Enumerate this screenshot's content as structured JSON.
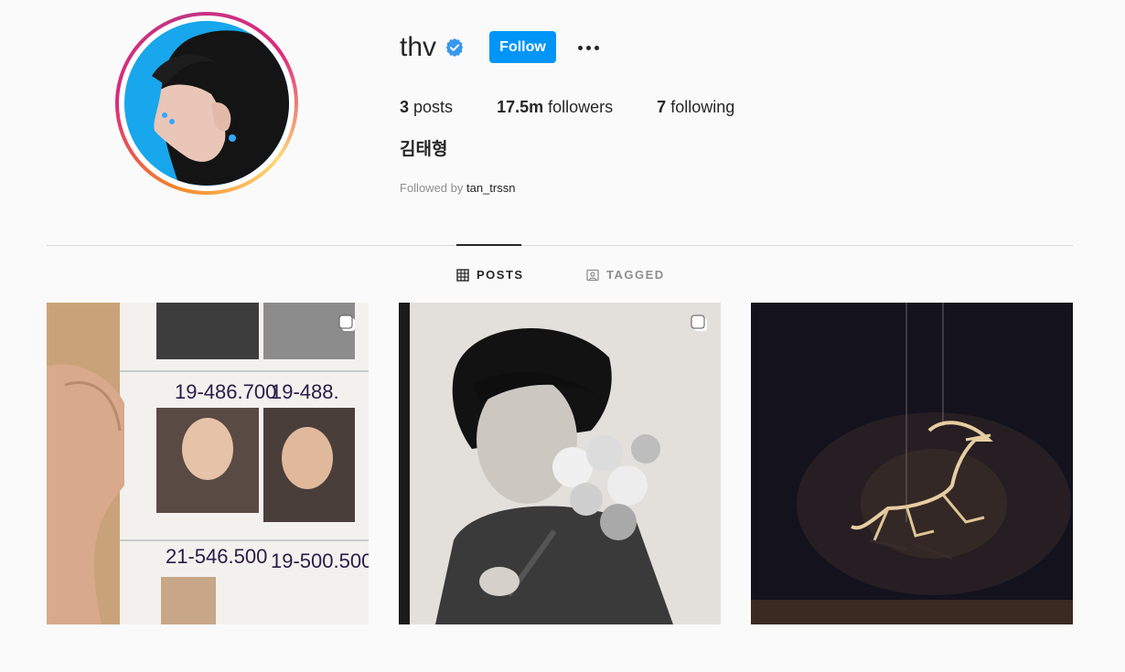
{
  "profile": {
    "username": "thv",
    "verified": true,
    "follow_label": "Follow",
    "full_name": "김태형",
    "followed_by_prefix": "Followed by",
    "followed_by_user": "tan_trssn"
  },
  "stats": {
    "posts_count": "3",
    "posts_label": "posts",
    "followers_count": "17.5m",
    "followers_label": "followers",
    "following_count": "7",
    "following_label": "following"
  },
  "tabs": {
    "posts_label": "POSTS",
    "tagged_label": "TAGGED",
    "active": "posts"
  },
  "posts": [
    {
      "multi": true,
      "icon": "carousel-icon"
    },
    {
      "multi": true,
      "icon": "carousel-icon"
    },
    {
      "multi": false
    }
  ],
  "colors": {
    "follow_button": "#0095f6",
    "verified_badge": "#3897f0",
    "text": "#262626",
    "muted": "#8e8e8e",
    "background": "#fafafa"
  }
}
